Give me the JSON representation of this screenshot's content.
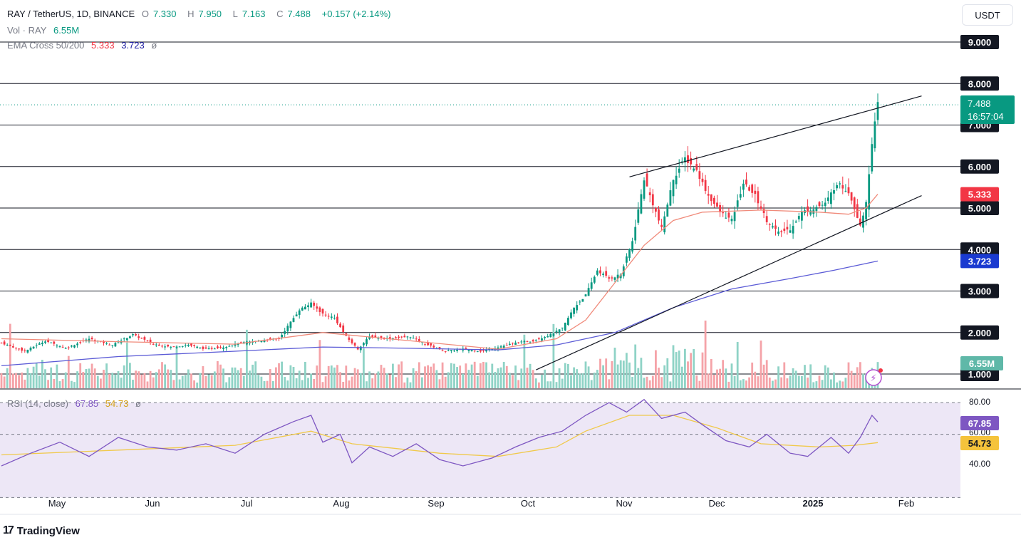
{
  "header": {
    "symbol": "RAY / TetherUS, 1D, BINANCE",
    "o_label": "O",
    "o_value": "7.330",
    "h_label": "H",
    "h_value": "7.950",
    "l_label": "L",
    "l_value": "7.163",
    "c_label": "C",
    "c_value": "7.488",
    "change": "+0.157 (+2.14%)",
    "vol_label": "Vol · RAY",
    "vol_value": "6.55M",
    "ema_label": "EMA Cross 50/200",
    "ema50_value": "5.333",
    "ema200_value": "3.723",
    "ema_symbol": "ø",
    "rsi_label": "RSI (14, close)",
    "rsi_value": "67.85",
    "rsi_ma_value": "54.73",
    "rsi_symbol": "ø"
  },
  "currency_button": "USDT",
  "branding": {
    "logo_mark": "17",
    "name": "TradingView"
  },
  "colors": {
    "up": "#089981",
    "down": "#f23645",
    "ema50": "#f08a7a",
    "ema200": "#5b5bd6",
    "rsi": "#7e57c2",
    "rsi_ma": "#f0c94a",
    "rsi_band": "#ede7f6",
    "level_line": "#131722"
  },
  "chart_data": {
    "type": "candlestick",
    "x_ticks": [
      "May",
      "Jun",
      "Jul",
      "Aug",
      "Sep",
      "Oct",
      "Nov",
      "Dec",
      "2025",
      "Feb"
    ],
    "y_ticks": [
      "1.000",
      "2.000",
      "3.000",
      "4.000",
      "5.000",
      "6.000",
      "7.000",
      "8.000",
      "9.000"
    ],
    "horizontal_levels": [
      1,
      2,
      3,
      4,
      5,
      6,
      7,
      8,
      9
    ],
    "price_labels": {
      "last": "7.488",
      "countdown": "16:57:04",
      "ema50": "5.333",
      "ema200": "3.723",
      "volume": "6.55M"
    },
    "rsi_ticks": [
      "80.00",
      "60.00",
      "40.00"
    ],
    "rsi_labels": {
      "rsi": "67.85",
      "rsi_ma": "54.73"
    },
    "close_path": [
      [
        0,
        1.75
      ],
      [
        8,
        1.55
      ],
      [
        15,
        1.8
      ],
      [
        22,
        1.62
      ],
      [
        30,
        1.85
      ],
      [
        38,
        1.7
      ],
      [
        45,
        1.95
      ],
      [
        52,
        1.72
      ],
      [
        58,
        1.65
      ],
      [
        64,
        1.7
      ],
      [
        70,
        1.6
      ],
      [
        76,
        1.65
      ],
      [
        82,
        1.75
      ],
      [
        88,
        1.8
      ],
      [
        95,
        1.85
      ],
      [
        102,
        2.55
      ],
      [
        106,
        2.7
      ],
      [
        110,
        2.45
      ],
      [
        114,
        2.35
      ],
      [
        118,
        1.9
      ],
      [
        122,
        1.6
      ],
      [
        126,
        1.9
      ],
      [
        132,
        1.85
      ],
      [
        140,
        1.9
      ],
      [
        146,
        1.7
      ],
      [
        152,
        1.55
      ],
      [
        158,
        1.6
      ],
      [
        164,
        1.55
      ],
      [
        170,
        1.65
      ],
      [
        176,
        1.75
      ],
      [
        182,
        1.8
      ],
      [
        188,
        1.95
      ],
      [
        192,
        2.1
      ],
      [
        196,
        2.6
      ],
      [
        200,
        2.9
      ],
      [
        204,
        3.5
      ],
      [
        208,
        3.3
      ],
      [
        212,
        3.4
      ],
      [
        216,
        4.2
      ],
      [
        220,
        5.7
      ],
      [
        222,
        5.3
      ],
      [
        226,
        4.5
      ],
      [
        230,
        5.7
      ],
      [
        234,
        6.2
      ],
      [
        238,
        5.9
      ],
      [
        242,
        5.3
      ],
      [
        246,
        4.9
      ],
      [
        250,
        4.7
      ],
      [
        254,
        5.6
      ],
      [
        258,
        5.3
      ],
      [
        262,
        4.7
      ],
      [
        266,
        4.4
      ],
      [
        270,
        4.5
      ],
      [
        274,
        4.9
      ],
      [
        278,
        5.0
      ],
      [
        282,
        5.1
      ],
      [
        286,
        5.6
      ],
      [
        290,
        5.4
      ],
      [
        294,
        4.6
      ],
      [
        296,
        5.1
      ],
      [
        298,
        6.6
      ],
      [
        300,
        7.488
      ]
    ],
    "ema50_path": [
      [
        0,
        1.85
      ],
      [
        40,
        1.78
      ],
      [
        80,
        1.72
      ],
      [
        110,
        2.0
      ],
      [
        140,
        1.8
      ],
      [
        170,
        1.6
      ],
      [
        190,
        1.85
      ],
      [
        200,
        2.3
      ],
      [
        210,
        3.2
      ],
      [
        220,
        4.1
      ],
      [
        230,
        4.7
      ],
      [
        240,
        4.9
      ],
      [
        260,
        4.95
      ],
      [
        280,
        4.9
      ],
      [
        290,
        4.85
      ],
      [
        296,
        5.0
      ],
      [
        300,
        5.333
      ]
    ],
    "ema200_path": [
      [
        0,
        1.2
      ],
      [
        40,
        1.42
      ],
      [
        80,
        1.55
      ],
      [
        110,
        1.65
      ],
      [
        140,
        1.62
      ],
      [
        170,
        1.58
      ],
      [
        190,
        1.7
      ],
      [
        210,
        2.0
      ],
      [
        230,
        2.6
      ],
      [
        250,
        3.05
      ],
      [
        270,
        3.3
      ],
      [
        285,
        3.5
      ],
      [
        300,
        3.723
      ]
    ],
    "trendlines": [
      {
        "from": [
          215,
          5.75
        ],
        "to": [
          315,
          7.7
        ]
      },
      {
        "from": [
          183,
          1.1
        ],
        "to": [
          315,
          5.3
        ]
      }
    ],
    "rsi_ma_range": [
      40,
      80
    ],
    "rsi_path": [
      [
        0,
        40
      ],
      [
        10,
        48
      ],
      [
        20,
        55
      ],
      [
        30,
        46
      ],
      [
        40,
        58
      ],
      [
        50,
        52
      ],
      [
        60,
        50
      ],
      [
        70,
        54
      ],
      [
        80,
        48
      ],
      [
        90,
        60
      ],
      [
        100,
        68
      ],
      [
        106,
        72
      ],
      [
        110,
        55
      ],
      [
        116,
        60
      ],
      [
        120,
        42
      ],
      [
        126,
        52
      ],
      [
        134,
        46
      ],
      [
        142,
        54
      ],
      [
        150,
        44
      ],
      [
        158,
        40
      ],
      [
        168,
        45
      ],
      [
        176,
        52
      ],
      [
        184,
        58
      ],
      [
        192,
        62
      ],
      [
        200,
        72
      ],
      [
        208,
        80
      ],
      [
        214,
        74
      ],
      [
        220,
        82
      ],
      [
        226,
        70
      ],
      [
        234,
        74
      ],
      [
        240,
        66
      ],
      [
        248,
        56
      ],
      [
        256,
        52
      ],
      [
        262,
        60
      ],
      [
        270,
        48
      ],
      [
        276,
        46
      ],
      [
        284,
        58
      ],
      [
        290,
        48
      ],
      [
        294,
        58
      ],
      [
        298,
        72
      ],
      [
        300,
        67.85
      ]
    ],
    "rsi_ma_path": [
      [
        0,
        47
      ],
      [
        40,
        50
      ],
      [
        80,
        53
      ],
      [
        106,
        62
      ],
      [
        120,
        54
      ],
      [
        150,
        48
      ],
      [
        170,
        46
      ],
      [
        190,
        52
      ],
      [
        200,
        62
      ],
      [
        215,
        72
      ],
      [
        230,
        72
      ],
      [
        245,
        64
      ],
      [
        260,
        54
      ],
      [
        280,
        52
      ],
      [
        292,
        53
      ],
      [
        300,
        54.73
      ]
    ]
  }
}
